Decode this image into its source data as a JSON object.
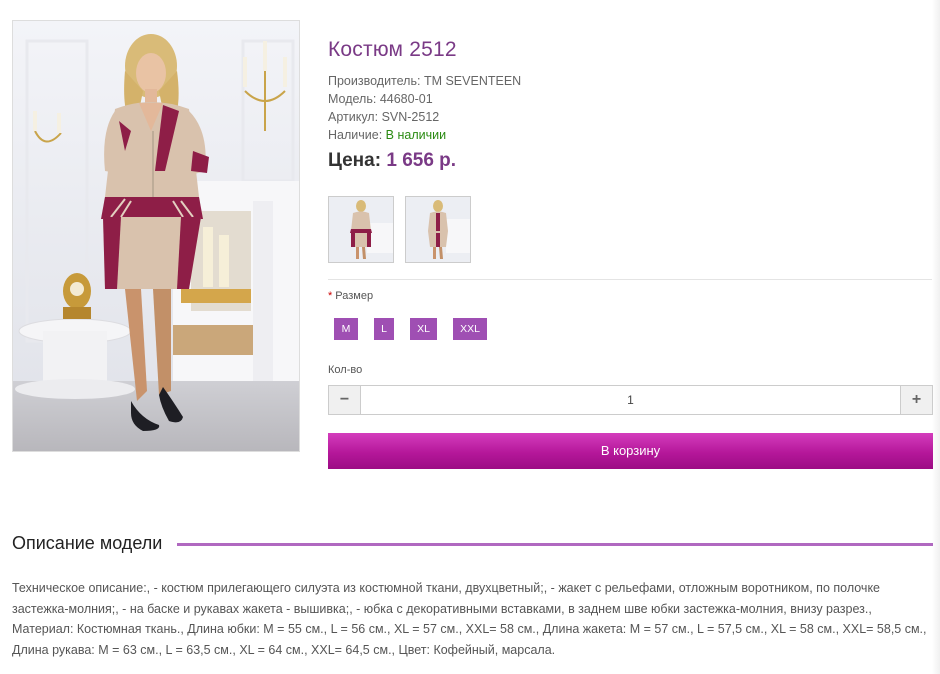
{
  "product": {
    "title": "Костюм 2512",
    "manufacturer_label": "Производитель:",
    "manufacturer_value": "TM SEVENTEEN",
    "model_label": "Модель:",
    "model_value": "44680-01",
    "sku_label": "Артикул:",
    "sku_value": "SVN-2512",
    "stock_label": "Наличие:",
    "stock_value": "В наличии",
    "price_label": "Цена:",
    "price_value": "1 656 р."
  },
  "options": {
    "size_required_mark": "*",
    "size_label": "Размер",
    "sizes": [
      "M",
      "L",
      "XL",
      "XXL"
    ],
    "qty_label": "Кол-во",
    "qty_value": "1",
    "minus": "−",
    "plus": "+"
  },
  "cart_button": "В корзину",
  "description": {
    "heading": "Описание модели",
    "text": "Техническое описание:, - костюм прилегающего силуэта из костюмной ткани, двухцветный;, - жакет с рельефами, отложным воротником, по полочке застежка-молния;, - на баске и рукавах жакета - вышивка;, - юбка с декоративными вставками, в заднем шве юбки застежка-молния, внизу разрез., Материал: Костюмная ткань., Длина юбки: M = 55 см., L = 56 см., XL = 57 см., XXL= 58 см., Длина жакета: M = 57 см., L = 57,5 см., XL = 58 см., XXL= 58,5 см., Длина рукава: M = 63 см., L = 63,5 см., XL = 64 см., XXL= 64,5 см., Цвет: Кофейный, марсала."
  },
  "colors": {
    "accent": "#7a3a86",
    "size_button": "#9f4fb3",
    "cart_button": "#b5179a",
    "in_stock": "#2a8a12"
  }
}
